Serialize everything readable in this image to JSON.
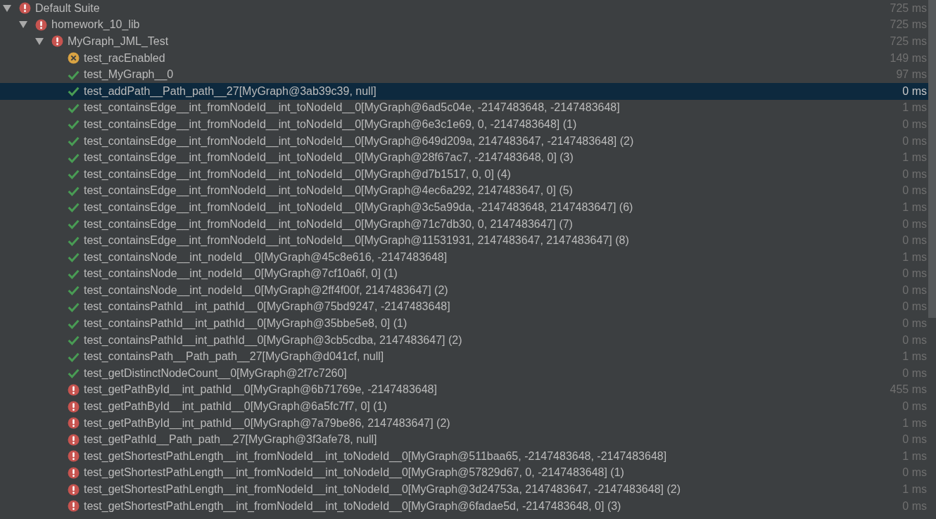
{
  "tree": [
    {
      "name": "Default Suite",
      "kind": "failed",
      "time": "725 ms",
      "expanded": true,
      "selected": false,
      "children": [
        {
          "name": "homework_10_lib",
          "kind": "failed",
          "time": "725 ms",
          "expanded": true,
          "selected": false,
          "children": [
            {
              "name": "MyGraph_JML_Test",
              "kind": "failed",
              "time": "725 ms",
              "expanded": true,
              "selected": false,
              "children": [
                {
                  "name": "test_racEnabled",
                  "kind": "ignored",
                  "time": "149 ms",
                  "selected": false
                },
                {
                  "name": "test_MyGraph__0",
                  "kind": "passed",
                  "time": "97 ms",
                  "selected": false
                },
                {
                  "name": "test_addPath__Path_path__27[MyGraph@3ab39c39, null]",
                  "kind": "passed",
                  "time": "0 ms",
                  "selected": true
                },
                {
                  "name": "test_containsEdge__int_fromNodeId__int_toNodeId__0[MyGraph@6ad5c04e, -2147483648, -2147483648]",
                  "kind": "passed",
                  "time": "1 ms",
                  "selected": false
                },
                {
                  "name": "test_containsEdge__int_fromNodeId__int_toNodeId__0[MyGraph@6e3c1e69, 0, -2147483648] (1)",
                  "kind": "passed",
                  "time": "0 ms",
                  "selected": false
                },
                {
                  "name": "test_containsEdge__int_fromNodeId__int_toNodeId__0[MyGraph@649d209a, 2147483647, -2147483648] (2)",
                  "kind": "passed",
                  "time": "0 ms",
                  "selected": false
                },
                {
                  "name": "test_containsEdge__int_fromNodeId__int_toNodeId__0[MyGraph@28f67ac7, -2147483648, 0] (3)",
                  "kind": "passed",
                  "time": "1 ms",
                  "selected": false
                },
                {
                  "name": "test_containsEdge__int_fromNodeId__int_toNodeId__0[MyGraph@d7b1517, 0, 0] (4)",
                  "kind": "passed",
                  "time": "0 ms",
                  "selected": false
                },
                {
                  "name": "test_containsEdge__int_fromNodeId__int_toNodeId__0[MyGraph@4ec6a292, 2147483647, 0] (5)",
                  "kind": "passed",
                  "time": "0 ms",
                  "selected": false
                },
                {
                  "name": "test_containsEdge__int_fromNodeId__int_toNodeId__0[MyGraph@3c5a99da, -2147483648, 2147483647] (6)",
                  "kind": "passed",
                  "time": "1 ms",
                  "selected": false
                },
                {
                  "name": "test_containsEdge__int_fromNodeId__int_toNodeId__0[MyGraph@71c7db30, 0, 2147483647] (7)",
                  "kind": "passed",
                  "time": "0 ms",
                  "selected": false
                },
                {
                  "name": "test_containsEdge__int_fromNodeId__int_toNodeId__0[MyGraph@11531931, 2147483647, 2147483647] (8)",
                  "kind": "passed",
                  "time": "0 ms",
                  "selected": false
                },
                {
                  "name": "test_containsNode__int_nodeId__0[MyGraph@45c8e616, -2147483648]",
                  "kind": "passed",
                  "time": "1 ms",
                  "selected": false
                },
                {
                  "name": "test_containsNode__int_nodeId__0[MyGraph@7cf10a6f, 0] (1)",
                  "kind": "passed",
                  "time": "0 ms",
                  "selected": false
                },
                {
                  "name": "test_containsNode__int_nodeId__0[MyGraph@2ff4f00f, 2147483647] (2)",
                  "kind": "passed",
                  "time": "0 ms",
                  "selected": false
                },
                {
                  "name": "test_containsPathId__int_pathId__0[MyGraph@75bd9247, -2147483648]",
                  "kind": "passed",
                  "time": "0 ms",
                  "selected": false
                },
                {
                  "name": "test_containsPathId__int_pathId__0[MyGraph@35bbe5e8, 0] (1)",
                  "kind": "passed",
                  "time": "0 ms",
                  "selected": false
                },
                {
                  "name": "test_containsPathId__int_pathId__0[MyGraph@3cb5cdba, 2147483647] (2)",
                  "kind": "passed",
                  "time": "0 ms",
                  "selected": false
                },
                {
                  "name": "test_containsPath__Path_path__27[MyGraph@d041cf, null]",
                  "kind": "passed",
                  "time": "1 ms",
                  "selected": false
                },
                {
                  "name": "test_getDistinctNodeCount__0[MyGraph@2f7c7260]",
                  "kind": "passed",
                  "time": "0 ms",
                  "selected": false
                },
                {
                  "name": "test_getPathById__int_pathId__0[MyGraph@6b71769e, -2147483648]",
                  "kind": "failed",
                  "time": "455 ms",
                  "selected": false
                },
                {
                  "name": "test_getPathById__int_pathId__0[MyGraph@6a5fc7f7, 0] (1)",
                  "kind": "failed",
                  "time": "0 ms",
                  "selected": false
                },
                {
                  "name": "test_getPathById__int_pathId__0[MyGraph@7a79be86, 2147483647] (2)",
                  "kind": "failed",
                  "time": "1 ms",
                  "selected": false
                },
                {
                  "name": "test_getPathId__Path_path__27[MyGraph@3f3afe78, null]",
                  "kind": "failed",
                  "time": "0 ms",
                  "selected": false
                },
                {
                  "name": "test_getShortestPathLength__int_fromNodeId__int_toNodeId__0[MyGraph@511baa65, -2147483648, -2147483648]",
                  "kind": "failed",
                  "time": "1 ms",
                  "selected": false
                },
                {
                  "name": "test_getShortestPathLength__int_fromNodeId__int_toNodeId__0[MyGraph@57829d67, 0, -2147483648] (1)",
                  "kind": "failed",
                  "time": "0 ms",
                  "selected": false
                },
                {
                  "name": "test_getShortestPathLength__int_fromNodeId__int_toNodeId__0[MyGraph@3d24753a, 2147483647, -2147483648] (2)",
                  "kind": "failed",
                  "time": "1 ms",
                  "selected": false
                },
                {
                  "name": "test_getShortestPathLength__int_fromNodeId__int_toNodeId__0[MyGraph@6fadae5d, -2147483648, 0] (3)",
                  "kind": "failed",
                  "time": "0 ms",
                  "selected": false
                }
              ]
            }
          ]
        }
      ]
    }
  ]
}
